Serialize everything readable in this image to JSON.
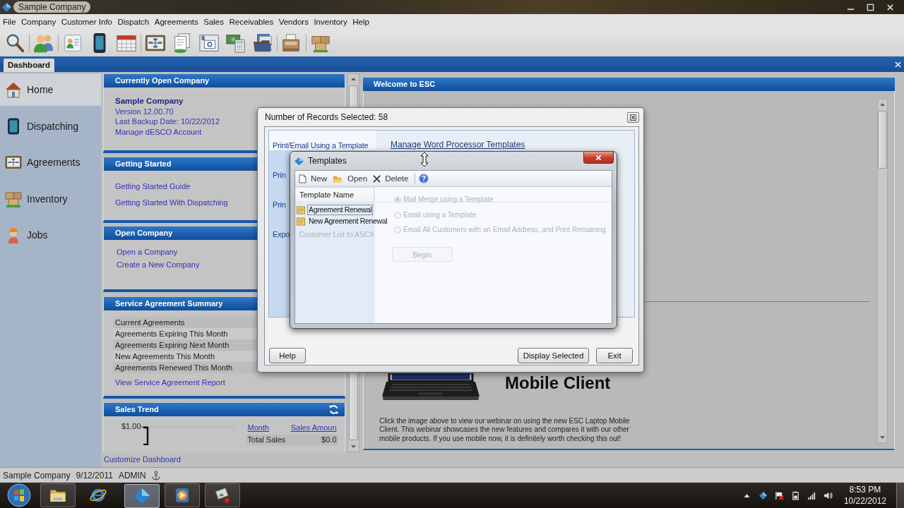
{
  "window": {
    "title": "Sample Company"
  },
  "menu": [
    "File",
    "Company",
    "Customer Info",
    "Dispatch",
    "Agreements",
    "Sales",
    "Receivables",
    "Vendors",
    "Inventory",
    "Help"
  ],
  "tabs": [
    {
      "label": "Dashboard",
      "selected": true
    }
  ],
  "sidebar": {
    "items": [
      {
        "label": "Home",
        "selected": true
      },
      {
        "label": "Dispatching",
        "selected": false
      },
      {
        "label": "Agreements",
        "selected": false
      },
      {
        "label": "Inventory",
        "selected": false
      },
      {
        "label": "Jobs",
        "selected": false
      }
    ]
  },
  "dashboard": {
    "current_company": {
      "title": "Currently Open Company",
      "name": "Sample Company",
      "version": "Version 12.00.70",
      "last_backup": "Last Backup Date: 10/22/2012",
      "account_link": "Manage dESCO Account"
    },
    "getting_started": {
      "title": "Getting Started",
      "links": [
        "Getting Started Guide",
        "Getting Started With Dispatching"
      ]
    },
    "open_company": {
      "title": "Open Company",
      "links": [
        "Open a Company",
        "Create a New Company"
      ]
    },
    "agreement_summary": {
      "title": "Service Agreement Summary",
      "rows": [
        "Current Agreements",
        "Agreements Expiring This Month",
        "Agreements Expiring Next Month",
        "New Agreements This Month",
        "Agreements Renewed This Month"
      ],
      "report_link": "View Service Agreement Report"
    },
    "sales_trend": {
      "title": "Sales Trend",
      "axis_label": "$1.00",
      "columns": [
        "Month",
        "Sales Amoun"
      ],
      "rows": [
        {
          "label": "Total Sales",
          "amount": "$0.0"
        }
      ]
    },
    "customize_link": "Customize Dashboard",
    "welcome": {
      "title": "Welcome to ESC",
      "promo_title": "Mobile Client",
      "promo_text": "Click the image above to view our webinar on using the new ESC Laptop Mobile Client. This webinar showcases the new features and compares it with our other mobile products. If you use mobile now, it is definitely worth checking this out!"
    }
  },
  "records_dialog": {
    "title": "Number of Records Selected: 58",
    "actions": [
      {
        "label": "Print/Email Using a Template",
        "selected": true
      },
      {
        "label": "Prin",
        "selected": false
      },
      {
        "label": "Prin",
        "selected": false
      },
      {
        "label": "Expo",
        "selected": false,
        "faded_tail": "Customer List to ASCII"
      }
    ],
    "manage_link": "Manage Word Processor Templates",
    "options": [
      {
        "label": "Mail Merge using a Template",
        "selected": true
      },
      {
        "label": "Email using a Template",
        "selected": false
      },
      {
        "label": "Email All Customers with an Email Address, and Print Remaining",
        "selected": false
      }
    ],
    "begin_button": "Begin",
    "help_button": "Help",
    "buttons": [
      "Display Selected",
      "Exit"
    ]
  },
  "templates_dialog": {
    "title": "Templates",
    "toolbar": [
      "New",
      "Open",
      "Delete"
    ],
    "column": "Template Name",
    "items": [
      {
        "name": "Agreement Renewal",
        "selected": true
      },
      {
        "name": "New Agreement Renewal",
        "selected": false
      }
    ]
  },
  "status_bar": {
    "company": "Sample Company",
    "date": "9/12/2011",
    "user": "ADMIN"
  },
  "taskbar": {
    "apps": [
      {
        "running": true,
        "selected": false
      },
      {
        "running": false,
        "selected": false
      },
      {
        "running": true,
        "selected": true
      },
      {
        "running": true,
        "selected": false
      },
      {
        "running": true,
        "selected": false
      }
    ],
    "clock": {
      "time": "8:53 PM",
      "date": "10/22/2012"
    }
  }
}
